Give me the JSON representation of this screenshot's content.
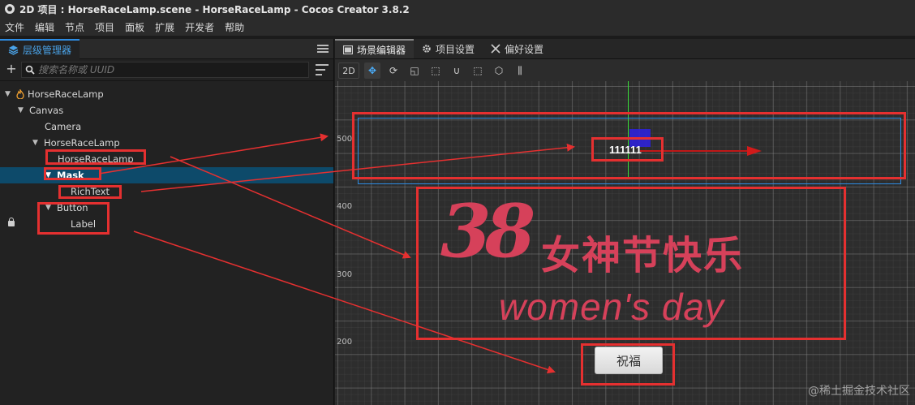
{
  "window": {
    "title": "2D 项目 : HorseRaceLamp.scene - HorseRaceLamp - Cocos Creator 3.8.2"
  },
  "menu": [
    "文件",
    "编辑",
    "节点",
    "项目",
    "面板",
    "扩展",
    "开发者",
    "帮助"
  ],
  "hierarchy": {
    "tab_label": "层级管理器",
    "search_placeholder": "搜索名称或 UUID",
    "nodes": [
      {
        "label": "HorseRaceLamp",
        "depth": 0,
        "expanded": true,
        "icon": "scene-flame-icon"
      },
      {
        "label": "Canvas",
        "depth": 1,
        "expanded": true
      },
      {
        "label": "Camera",
        "depth": 2,
        "expanded": null
      },
      {
        "label": "HorseRaceLamp",
        "depth": 2,
        "expanded": true
      },
      {
        "label": "HorseRaceLamp",
        "depth": 3,
        "expanded": null
      },
      {
        "label": "Mask",
        "depth": 3,
        "expanded": true,
        "selected": true
      },
      {
        "label": "RichText",
        "depth": 4,
        "expanded": null
      },
      {
        "label": "Button",
        "depth": 3,
        "expanded": true
      },
      {
        "label": "Label",
        "depth": 4,
        "expanded": null,
        "locked": true
      }
    ]
  },
  "right_tabs": [
    {
      "label": "场景编辑器",
      "icon": "scene-editor-icon",
      "active": true
    },
    {
      "label": "项目设置",
      "icon": "gear-icon",
      "active": false
    },
    {
      "label": "偏好设置",
      "icon": "tools-icon",
      "active": false
    }
  ],
  "scene_toolbar": {
    "mode_label": "2D"
  },
  "scene": {
    "axis_labels": [
      "500",
      "400",
      "300",
      "200"
    ],
    "marquee_text": "111111",
    "banner_big": "38",
    "banner_cn": "女神节快乐",
    "banner_en": "women's day",
    "button_label": "祝福"
  },
  "colors": {
    "accent_blue": "#2d8ce3",
    "annotation_red": "#e53030",
    "banner_pink": "#d6415a",
    "selection_bg": "#0d4a6a"
  },
  "watermark": "@稀土掘金技术社区"
}
